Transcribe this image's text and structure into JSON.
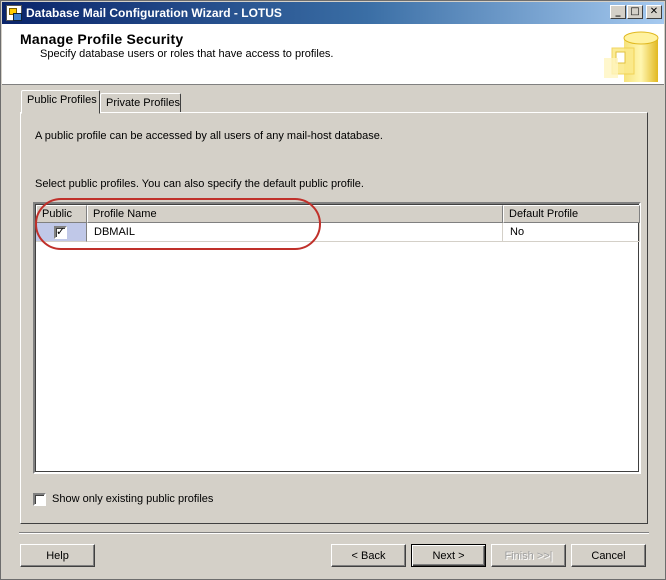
{
  "window": {
    "title": "Database Mail Configuration Wizard - LOTUS",
    "controls": {
      "minimize": "_",
      "maximize": "□",
      "close": "✕"
    },
    "icon": "app-icon"
  },
  "header": {
    "title": "Manage Profile Security",
    "subtitle": "Specify database users or roles that have access to profiles.",
    "graphic": "database-icon"
  },
  "tabs": [
    {
      "label": "Public Profiles",
      "active": true
    },
    {
      "label": "Private Profiles",
      "active": false
    }
  ],
  "panel": {
    "description": "A public profile can be accessed by all users of any mail-host database.",
    "instruction": "Select public profiles. You can also specify the default public profile.",
    "show_existing_label": "Show only existing public profiles",
    "show_existing_checked": false
  },
  "grid": {
    "columns": [
      "Public",
      "Profile Name",
      "Default Profile"
    ],
    "rows": [
      {
        "public": true,
        "profile_name": "DBMAIL",
        "default_profile": "No"
      }
    ]
  },
  "buttons": {
    "help": "Help",
    "back": "< Back",
    "next": "Next >",
    "finish": "Finish >>|",
    "cancel": "Cancel"
  },
  "colors": {
    "annotation_ring": "#c0302a",
    "selected_cell": "#c0c8e8",
    "title_bar_start": "#0a246a"
  }
}
